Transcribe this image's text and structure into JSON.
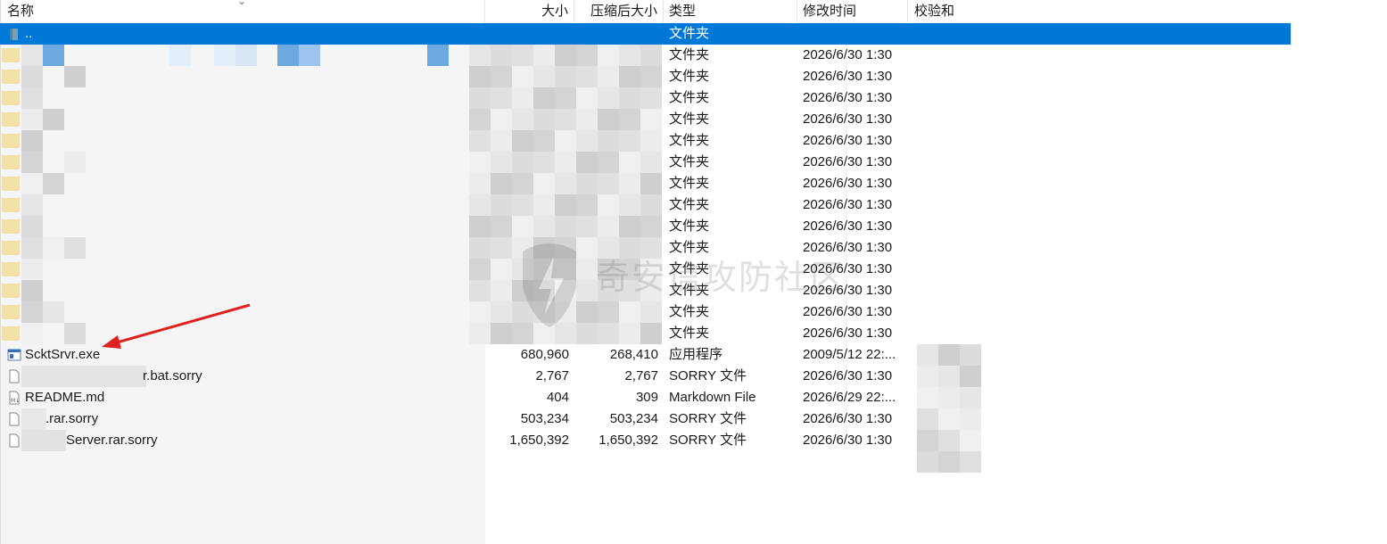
{
  "header": {
    "name": "名称",
    "size": "大小",
    "packed": "压缩后大小",
    "type": "类型",
    "modified": "修改时间",
    "checksum": "校验和"
  },
  "parent_row": {
    "name": "..",
    "type": "文件夹"
  },
  "folder_rows": [
    {
      "type": "文件夹",
      "modified": "2026/6/30 1:30"
    },
    {
      "type": "文件夹",
      "modified": "2026/6/30 1:30"
    },
    {
      "type": "文件夹",
      "modified": "2026/6/30 1:30"
    },
    {
      "type": "文件夹",
      "modified": "2026/6/30 1:30"
    },
    {
      "type": "文件夹",
      "modified": "2026/6/30 1:30"
    },
    {
      "type": "文件夹",
      "modified": "2026/6/30 1:30"
    },
    {
      "type": "文件夹",
      "modified": "2026/6/30 1:30"
    },
    {
      "type": "文件夹",
      "modified": "2026/6/30 1:30"
    },
    {
      "type": "文件夹",
      "modified": "2026/6/30 1:30"
    },
    {
      "type": "文件夹",
      "modified": "2026/6/30 1:30"
    },
    {
      "type": "文件夹",
      "modified": "2026/6/30 1:30"
    },
    {
      "type": "文件夹",
      "modified": "2026/6/30 1:30"
    },
    {
      "type": "文件夹",
      "modified": "2026/6/30 1:30"
    },
    {
      "type": "文件夹",
      "modified": "2026/6/30 1:30"
    }
  ],
  "file_rows": [
    {
      "name": "ScktSrvr.exe",
      "size": "680,960",
      "packed": "268,410",
      "type": "应用程序",
      "modified": "2009/5/12 22:...",
      "icon": "application-icon"
    },
    {
      "name": "r.bat.sorry",
      "size": "2,767",
      "packed": "2,767",
      "type": "SORRY 文件",
      "modified": "2026/6/30 1:30",
      "icon": "file-icon"
    },
    {
      "name": "README.md",
      "size": "404",
      "packed": "309",
      "type": "Markdown File",
      "modified": "2026/6/29 22:...",
      "icon": "markdown-icon"
    },
    {
      "name": ".rar.sorry",
      "size": "503,234",
      "packed": "503,234",
      "type": "SORRY 文件",
      "modified": "2026/6/30 1:30",
      "icon": "file-icon"
    },
    {
      "name": "Server.rar.sorry",
      "size": "1,650,392",
      "packed": "1,650,392",
      "type": "SORRY 文件",
      "modified": "2026/6/30 1:30",
      "icon": "file-icon"
    }
  ],
  "watermark": "奇安信攻防社区",
  "colors": {
    "selection": "#0078d7",
    "arrow": "#e02020"
  }
}
